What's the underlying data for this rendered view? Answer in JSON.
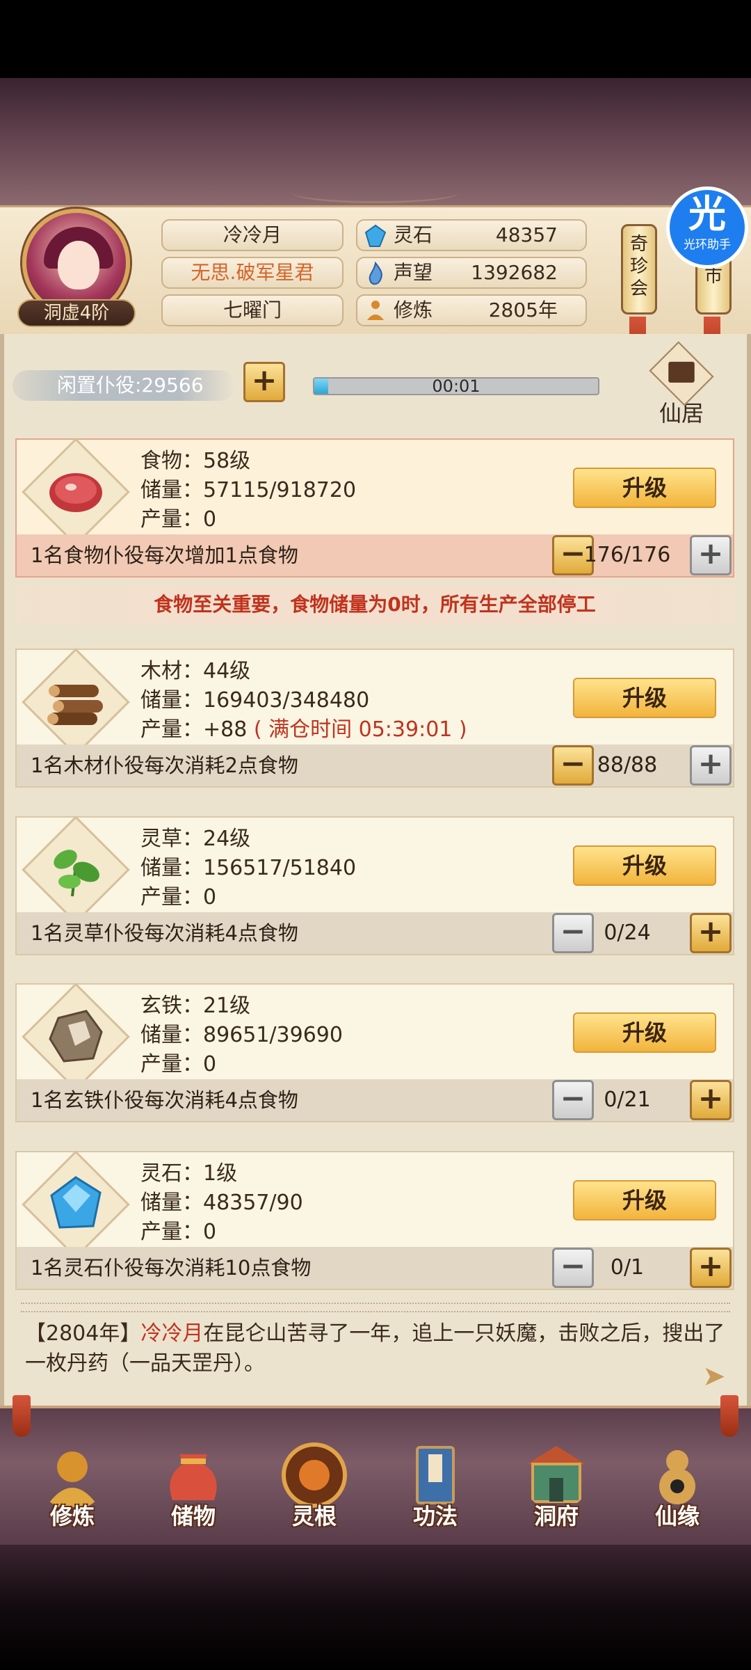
{
  "player": {
    "name": "冷冷月",
    "title": "无思.破军星君",
    "sect": "七曜门",
    "rank": "洞虚4阶"
  },
  "resources": [
    {
      "label": "灵石",
      "value": "48357",
      "icon": "blue-crystal-icon",
      "color": "#3fa9e8"
    },
    {
      "label": "声望",
      "value": "1392682",
      "icon": "blue-flame-icon",
      "color": "#5a9de0"
    },
    {
      "label": "修炼",
      "value": "2805年",
      "icon": "meditation-icon",
      "color": "#d9882e"
    }
  ],
  "side_buttons": {
    "treasure": "奇\n珍\n会",
    "market": "市"
  },
  "helper": {
    "glyph": "光",
    "label": "光环助手"
  },
  "idle": {
    "label": "闲置仆役:29566",
    "progress_time": "00:01",
    "progress_fraction": 0.05
  },
  "residence": {
    "label": "仙居"
  },
  "cards": [
    {
      "name_level": "食物：58级",
      "storage": "储量：57115/918720",
      "output": "产量：0",
      "output_extra": "",
      "upgrade_label": "升级",
      "footer": "1名食物仆役每次增加1点食物",
      "count": "176/176",
      "icon": "meat-icon",
      "icon_color": "#c2373c",
      "minus_active": true,
      "plus_active": false
    },
    {
      "name_level": "木材：44级",
      "storage": "储量：169403/348480",
      "output": "产量：+88",
      "output_extra": "( 满仓时间 05:39:01 )",
      "upgrade_label": "升级",
      "footer": "1名木材仆役每次消耗2点食物",
      "count": "88/88",
      "icon": "wood-logs-icon",
      "icon_color": "#7a4a22",
      "minus_active": true,
      "plus_active": false
    },
    {
      "name_level": "灵草：24级",
      "storage": "储量：156517/51840",
      "output": "产量：0",
      "output_extra": "",
      "upgrade_label": "升级",
      "footer": "1名灵草仆役每次消耗4点食物",
      "count": "0/24",
      "icon": "herb-leaf-icon",
      "icon_color": "#4a9a32",
      "minus_active": false,
      "plus_active": true
    },
    {
      "name_level": "玄铁：21级",
      "storage": "储量：89651/39690",
      "output": "产量：0",
      "output_extra": "",
      "upgrade_label": "升级",
      "footer": "1名玄铁仆役每次消耗4点食物",
      "count": "0/21",
      "icon": "iron-ore-icon",
      "icon_color": "#8e7a62",
      "minus_active": false,
      "plus_active": true
    },
    {
      "name_level": "灵石：1级",
      "storage": "储量：48357/90",
      "output": "产量：0",
      "output_extra": "",
      "upgrade_label": "升级",
      "footer": "1名灵石仆役每次消耗10点食物",
      "count": "0/1",
      "icon": "spirit-stone-icon",
      "icon_color": "#3aa6e6",
      "minus_active": false,
      "plus_active": true
    }
  ],
  "warning": "食物至关重要，食物储量为0时，所有生产全部停工",
  "log": {
    "year": "【2804年】",
    "name": "冷冷月",
    "text": "在昆仑山苦寻了一年，追上一只妖魔，击败之后，搜出了一枚丹药（一品天罡丹）。"
  },
  "nav": [
    {
      "label": "修炼",
      "icon": "cultivation-icon",
      "color": "#d8932e"
    },
    {
      "label": "储物",
      "icon": "storage-bag-icon",
      "color": "#d9513c"
    },
    {
      "label": "灵根",
      "icon": "spirit-root-icon",
      "color": "#c8631e"
    },
    {
      "label": "功法",
      "icon": "technique-book-icon",
      "color": "#3e6fa8"
    },
    {
      "label": "洞府",
      "icon": "cave-dwelling-icon",
      "color": "#4c8a6a"
    },
    {
      "label": "仙缘",
      "icon": "fortune-gourd-icon",
      "color": "#d9a452"
    }
  ]
}
